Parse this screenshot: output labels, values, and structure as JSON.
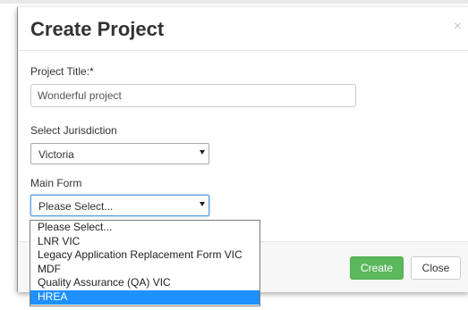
{
  "modal": {
    "title": "Create Project",
    "close_icon": "×"
  },
  "form": {
    "project_title_label": "Project Title:*",
    "project_title_value": "Wonderful project",
    "jurisdiction_label": "Select Jurisdiction",
    "jurisdiction_value": "Victoria",
    "main_form_label": "Main Form",
    "main_form_value": "Please Select..."
  },
  "dropdown": {
    "options": [
      "Please Select...",
      "LNR VIC",
      "Legacy Application Replacement Form VIC",
      "MDF",
      "Quality Assurance (QA) VIC",
      "HREA"
    ],
    "highlighted_option": "HREA"
  },
  "footer": {
    "create_label": "Create",
    "close_label": "Close"
  },
  "icons": {
    "close": "close-icon",
    "dropdown_arrow": "chevron-down-icon"
  },
  "colors": {
    "create_button": "#5cb85c",
    "highlight": "#1e90ff",
    "focus_border": "#5b9dd9"
  }
}
